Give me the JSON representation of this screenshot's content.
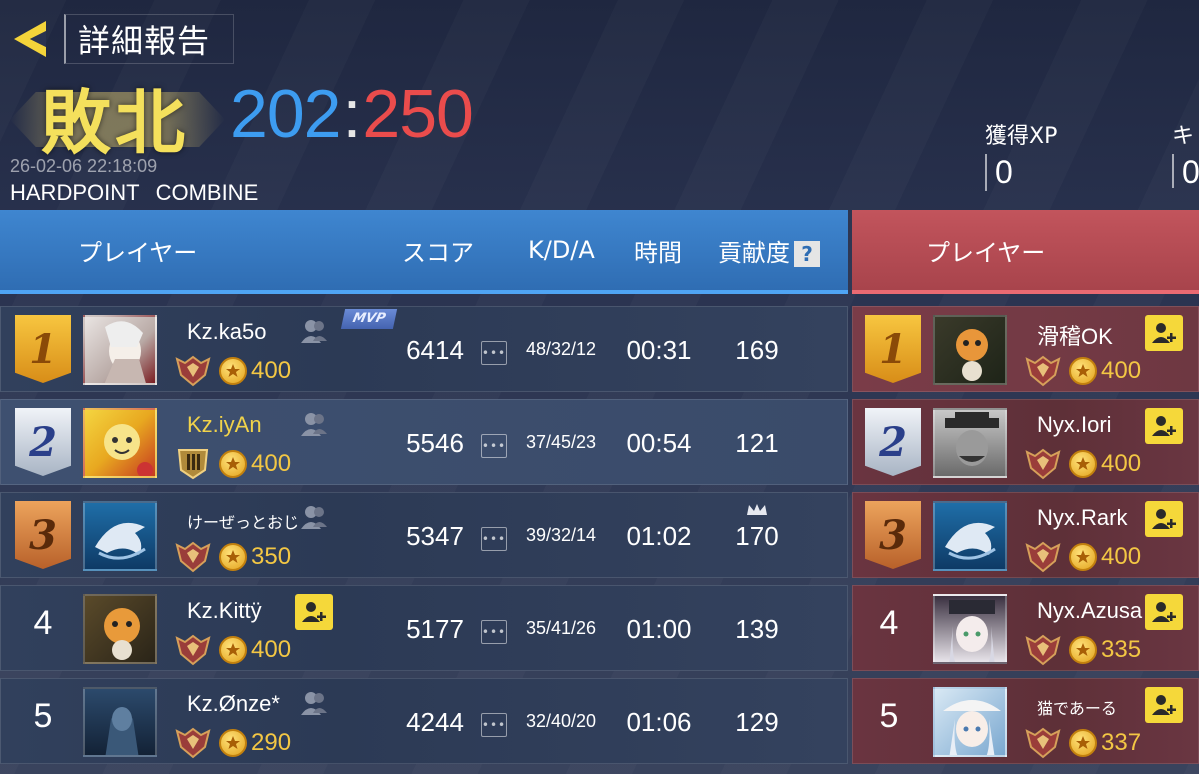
{
  "header": {
    "title": "詳細報告",
    "result": "敗北",
    "score_blue": "202",
    "score_sep": ":",
    "score_red": "250",
    "timestamp": "26-02-06 22:18:09",
    "mode": "HARDPOINT",
    "map": "COMBINE",
    "stats": [
      {
        "label": "獲得XP",
        "value": "0"
      },
      {
        "label": "キ",
        "value": "0."
      }
    ]
  },
  "columns": {
    "player": "プレイヤー",
    "score": "スコア",
    "kda": "K/D/A",
    "time": "時間",
    "contribution": "貢献度",
    "help": "?",
    "enemy_player": "プレイヤー"
  },
  "blue_team": [
    {
      "rank": "1",
      "name": "Kz.ka5o",
      "points": "400",
      "score": "6414",
      "kda": "48/32/12",
      "time": "00:31",
      "contribution": "169",
      "mvp": "MVP"
    },
    {
      "rank": "2",
      "name": "Kz.iyAn",
      "points": "400",
      "score": "5546",
      "kda": "37/45/23",
      "time": "00:54",
      "contribution": "121"
    },
    {
      "rank": "3",
      "name": "けーぜっとおじ",
      "points": "350",
      "score": "5347",
      "kda": "39/32/14",
      "time": "01:02",
      "contribution": "170"
    },
    {
      "rank": "4",
      "name": "Kz.Kittÿ",
      "points": "400",
      "score": "5177",
      "kda": "35/41/26",
      "time": "01:00",
      "contribution": "139"
    },
    {
      "rank": "5",
      "name": "Kz.Ønze*",
      "points": "290",
      "score": "4244",
      "kda": "32/40/20",
      "time": "01:06",
      "contribution": "129"
    }
  ],
  "red_team": [
    {
      "rank": "1",
      "name": "滑稽OK",
      "points": "400"
    },
    {
      "rank": "2",
      "name": "Nyx.Iori",
      "points": "400"
    },
    {
      "rank": "3",
      "name": "Nyx.Rark",
      "points": "400"
    },
    {
      "rank": "4",
      "name": "Nyx.Azusa",
      "points": "335"
    },
    {
      "rank": "5",
      "name": "猫であーる",
      "points": "337"
    }
  ],
  "colors": {
    "blue_accent": "#3d9cf0",
    "red_accent": "#ea4c4c",
    "defeat_gold": "#f4e05c",
    "points_gold": "#f3c744"
  }
}
